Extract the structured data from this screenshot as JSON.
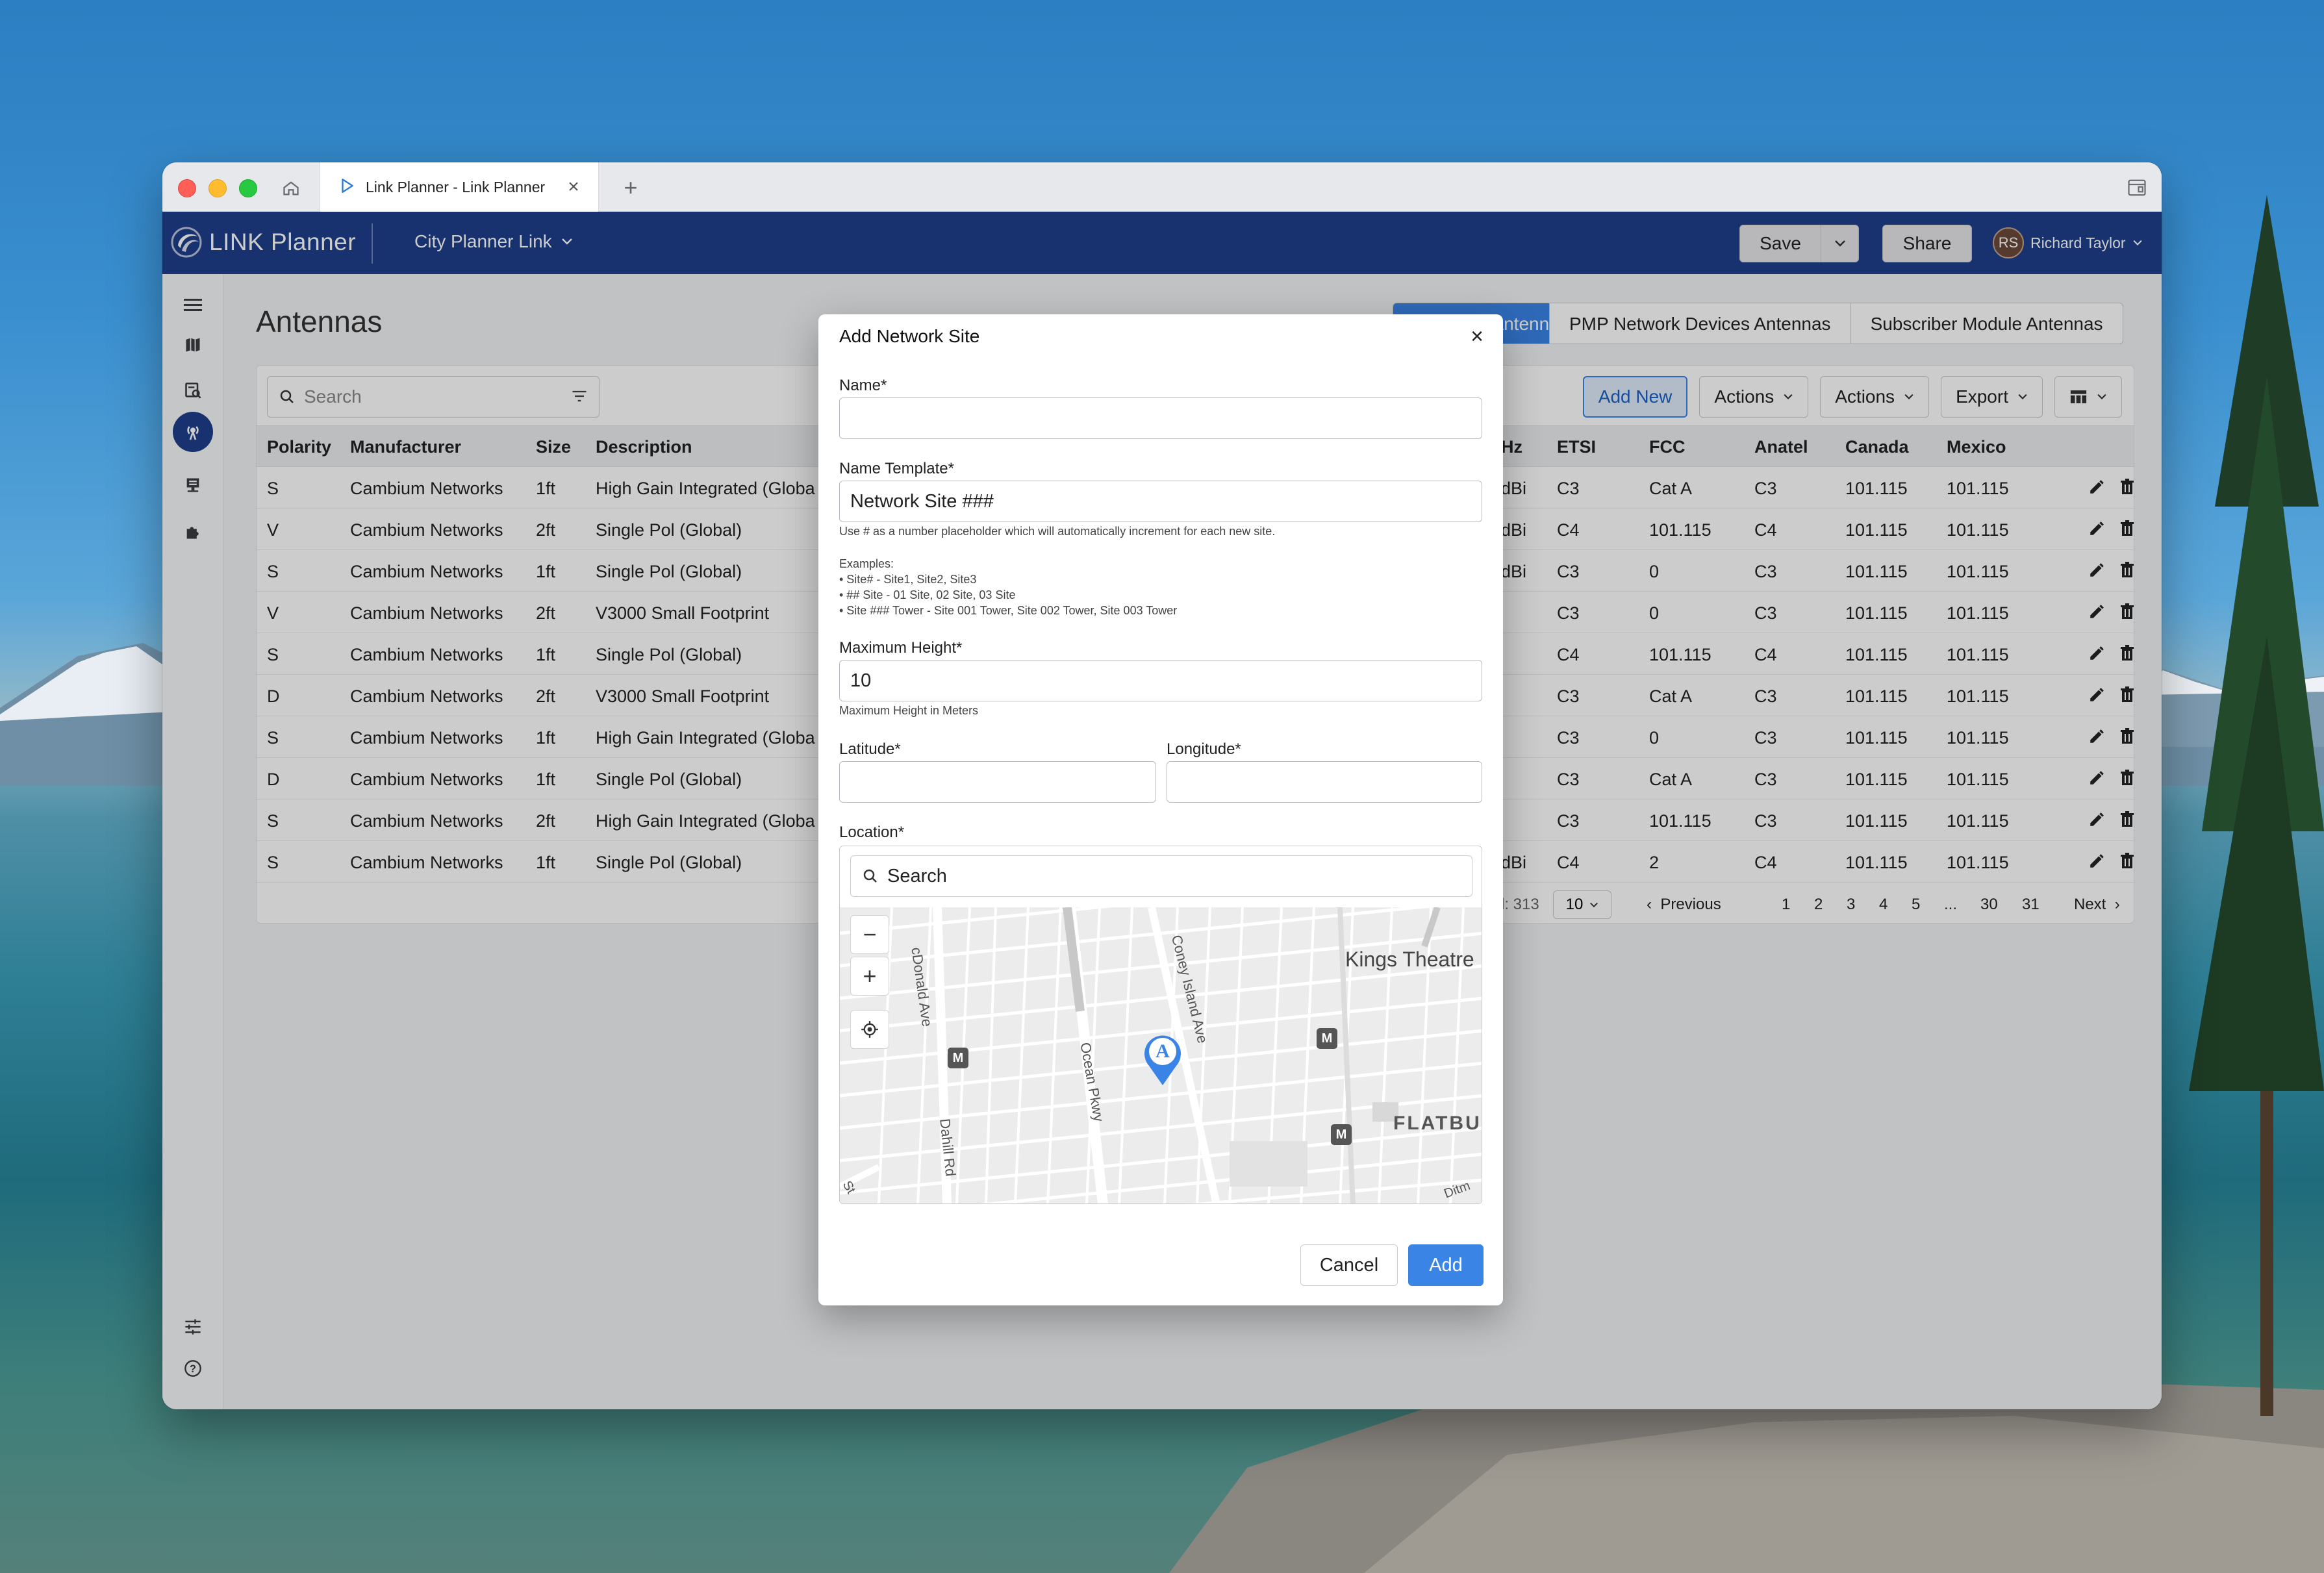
{
  "browser": {
    "tab_title": "Link Planner - Link Planner",
    "new_tab": "+"
  },
  "app": {
    "logo_text": "LINK Planner",
    "project_name": "City Planner Link",
    "save_label": "Save",
    "share_label": "Share",
    "user_initials": "RS",
    "user_name": "Richard Taylor"
  },
  "page": {
    "title": "Antennas",
    "tabs": [
      "Backhaul Antennas",
      "PMP Network Devices Antennas",
      "Subscriber Module Antennas"
    ],
    "search_placeholder": "Search",
    "toolbar": {
      "add_new": "Add New",
      "actions1": "Actions",
      "actions2": "Actions",
      "export": "Export"
    }
  },
  "table": {
    "headers": {
      "polarity": "Polarity",
      "manufacturer": "Manufacturer",
      "size": "Size",
      "description": "Description",
      "hz": "Hz",
      "etsi": "ETSI",
      "fcc": "FCC",
      "anatel": "Anatel",
      "canada": "Canada",
      "mexico": "Mexico"
    },
    "rows": [
      {
        "polarity": "S",
        "manufacturer": "Cambium Networks",
        "size": "1ft",
        "description": "High Gain Integrated (Globa",
        "hz": "dBi",
        "etsi": "C3",
        "fcc": "Cat A",
        "anatel": "C3",
        "canada": "101.115",
        "mexico": "101.115"
      },
      {
        "polarity": "V",
        "manufacturer": "Cambium Networks",
        "size": "2ft",
        "description": "Single Pol (Global)",
        "hz": "dBi",
        "etsi": "C4",
        "fcc": "101.115",
        "anatel": "C4",
        "canada": "101.115",
        "mexico": "101.115"
      },
      {
        "polarity": "S",
        "manufacturer": "Cambium Networks",
        "size": "1ft",
        "description": "Single Pol (Global)",
        "hz": "dBi",
        "etsi": "C3",
        "fcc": "0",
        "anatel": "C3",
        "canada": "101.115",
        "mexico": "101.115"
      },
      {
        "polarity": "V",
        "manufacturer": "Cambium Networks",
        "size": "2ft",
        "description": "V3000 Small Footprint",
        "hz": "",
        "etsi": "C3",
        "fcc": "0",
        "anatel": "C3",
        "canada": "101.115",
        "mexico": "101.115"
      },
      {
        "polarity": "S",
        "manufacturer": "Cambium Networks",
        "size": "1ft",
        "description": "Single Pol (Global)",
        "hz": "",
        "etsi": "C4",
        "fcc": "101.115",
        "anatel": "C4",
        "canada": "101.115",
        "mexico": "101.115"
      },
      {
        "polarity": "D",
        "manufacturer": "Cambium Networks",
        "size": "2ft",
        "description": "V3000 Small Footprint",
        "hz": "",
        "etsi": "C3",
        "fcc": "Cat A",
        "anatel": "C3",
        "canada": "101.115",
        "mexico": "101.115"
      },
      {
        "polarity": "S",
        "manufacturer": "Cambium Networks",
        "size": "1ft",
        "description": "High Gain Integrated (Globa",
        "hz": "",
        "etsi": "C3",
        "fcc": "0",
        "anatel": "C3",
        "canada": "101.115",
        "mexico": "101.115"
      },
      {
        "polarity": "D",
        "manufacturer": "Cambium Networks",
        "size": "1ft",
        "description": "Single Pol (Global)",
        "hz": "",
        "etsi": "C3",
        "fcc": "Cat A",
        "anatel": "C3",
        "canada": "101.115",
        "mexico": "101.115"
      },
      {
        "polarity": "S",
        "manufacturer": "Cambium Networks",
        "size": "2ft",
        "description": "High Gain Integrated (Globa",
        "hz": "",
        "etsi": "C3",
        "fcc": "101.115",
        "anatel": "C3",
        "canada": "101.115",
        "mexico": "101.115"
      },
      {
        "polarity": "S",
        "manufacturer": "Cambium Networks",
        "size": "1ft",
        "description": "Single Pol (Global)",
        "hz": "dBi",
        "etsi": "C4",
        "fcc": "2",
        "anatel": "C4",
        "canada": "101.115",
        "mexico": "101.115"
      }
    ]
  },
  "pagination": {
    "total": "l: 313",
    "per_page": "10",
    "previous": "Previous",
    "pages": [
      "1",
      "2",
      "3",
      "4",
      "5",
      "...",
      "30",
      "31"
    ],
    "next": "Next"
  },
  "modal": {
    "title": "Add Network Site",
    "name_label": "Name*",
    "name_value": "",
    "template_label": "Name Template*",
    "template_value": "Network Site ###",
    "template_help": "Use # as a number placeholder which will automatically increment for each new site.",
    "examples_title": "Examples:",
    "examples": [
      "• Site# - Site1, Site2, Site3",
      "• ## Site - 01 Site, 02 Site, 03 Site",
      "• Site ### Tower - Site 001 Tower, Site 002 Tower, Site 003 Tower"
    ],
    "height_label": "Maximum Height*",
    "height_value": "10",
    "height_help": "Maximum Height in Meters",
    "latitude_label": "Latitude*",
    "longitude_label": "Longitude*",
    "location_label": "Location*",
    "map_search_placeholder": "Search",
    "map_labels": {
      "mcdonald": "cDonald Ave",
      "coney": "Coney Island Ave",
      "ocean": "Ocean Pkwy",
      "dahill": "Dahill Rd",
      "kings": "Kings Theatre",
      "flatbush": "FLATBUS",
      "ditmas": "Ditm",
      "st": "St",
      "marker": "A",
      "metro": "M"
    },
    "cancel_label": "Cancel",
    "add_label": "Add"
  },
  "colors": {
    "appbar": "#1d3f8a",
    "primary": "#3a84e6"
  }
}
